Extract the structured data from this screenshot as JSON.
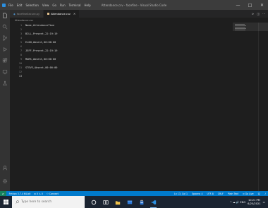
{
  "window": {
    "menu": [
      "File",
      "Edit",
      "Selection",
      "View",
      "Go",
      "Run",
      "Terminal",
      "Help"
    ],
    "title": "Attendance.csv - facefine - Visual Studio Code",
    "buttons": [
      "—",
      "□",
      "✕"
    ]
  },
  "tabs": [
    {
      "label": "facefineSecure.py",
      "active": false
    },
    {
      "label": "Attendance.csv",
      "active": true
    }
  ],
  "tab_close": "×",
  "tab_actions": [
    "⊳",
    "◫",
    "···"
  ],
  "breadcrumb": "Attendance.csv",
  "editor": {
    "lines": [
      {
        "num": "1",
        "text": "Name,AttendanceTime"
      },
      {
        "num": "2",
        "text": ""
      },
      {
        "num": "3",
        "text": "BILL,Present,22:19:19"
      },
      {
        "num": "4",
        "text": ""
      },
      {
        "num": "5",
        "text": "ELON,Absent,00:00:00"
      },
      {
        "num": "6",
        "text": ""
      },
      {
        "num": "7",
        "text": "JEFF,Present,22:19:19"
      },
      {
        "num": "8",
        "text": ""
      },
      {
        "num": "9",
        "text": "MARK,Absent,00:00:00"
      },
      {
        "num": "10",
        "text": ""
      },
      {
        "num": "11",
        "text": "STEVE,Absent,00:00:00"
      },
      {
        "num": "12",
        "text": ""
      },
      {
        "num": "13",
        "text": ""
      }
    ]
  },
  "statusbar": {
    "remote": "⇄",
    "branch": "Python 3.7.4 64-bit",
    "problems": "⊗ 0 ⚠ 0",
    "connect": "⚇ Connect",
    "position": "Ln 13, Col 1",
    "spaces": "Spaces: 4",
    "encoding": "UTF-8",
    "eol": "CRLF",
    "language": "Plain Text",
    "golive": "⊙ Go Live"
  },
  "taskbar": {
    "search_placeholder": "Type here to search",
    "time": "10:21 PM",
    "date": "6/25/2021",
    "tray": "^ ☁ 🔊 ENG"
  },
  "colors": {
    "accent": "#007acc",
    "activity_bar": "#333333",
    "editor_bg": "#1e1e1e",
    "taskbar": "#1b2431"
  }
}
